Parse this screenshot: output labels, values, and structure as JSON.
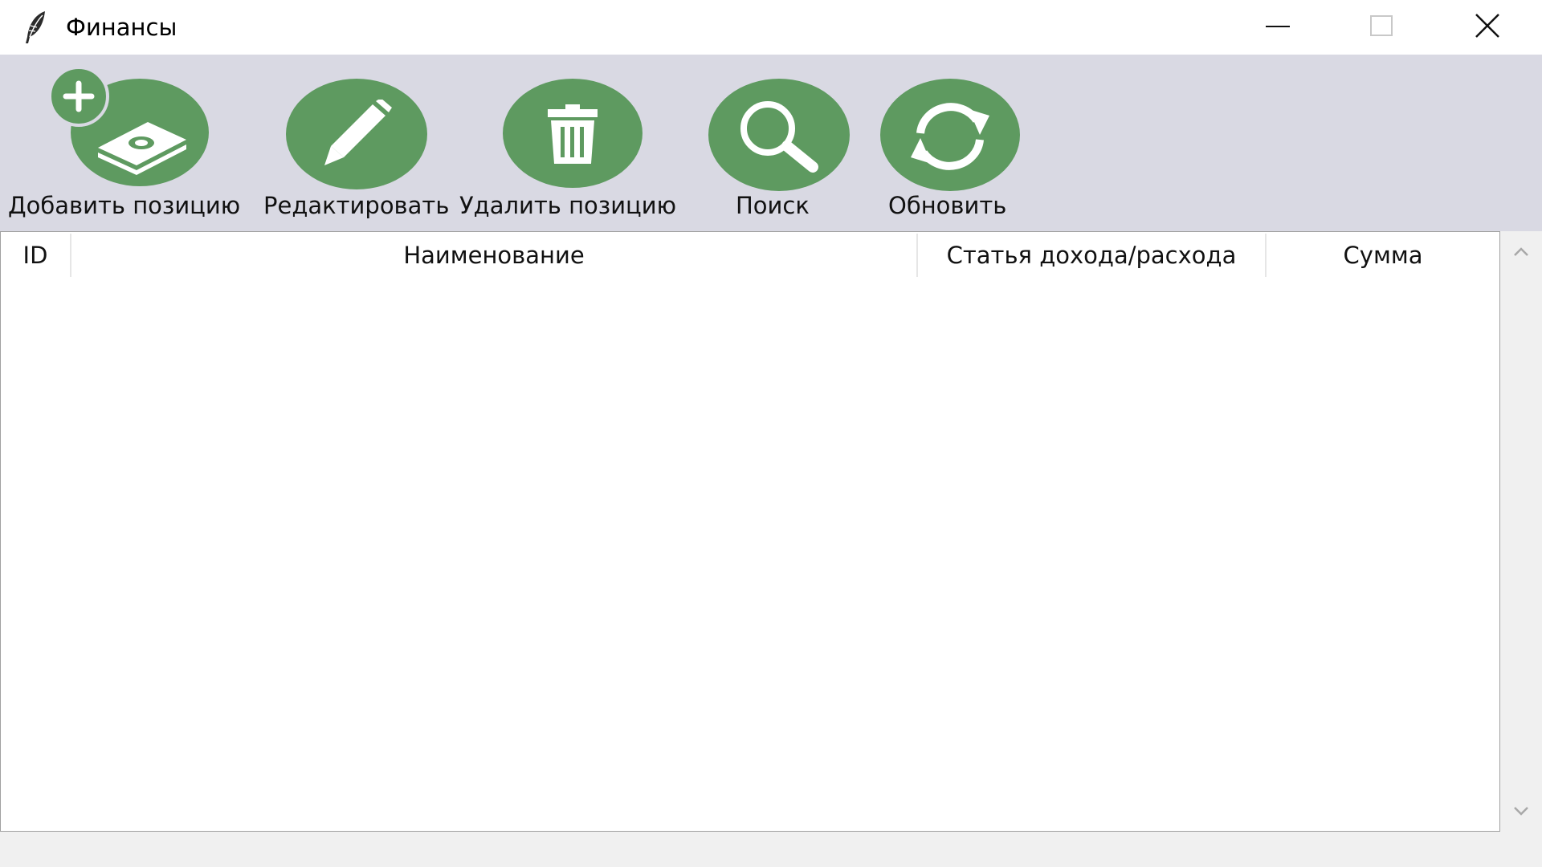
{
  "window": {
    "title": "Финансы",
    "app_icon": "feather-icon",
    "controls": {
      "minimize_icon": "minimize-icon",
      "maximize_icon": "maximize-icon",
      "close_icon": "close-icon"
    }
  },
  "toolbar": {
    "background": "#d9d9e3",
    "accent": "#5e9a60",
    "buttons": [
      {
        "label": "Добавить позицию",
        "icon": "add-money-icon"
      },
      {
        "label": "Редактировать",
        "icon": "pencil-icon"
      },
      {
        "label": "Удалить позицию",
        "icon": "trash-icon"
      },
      {
        "label": "Поиск",
        "icon": "search-icon"
      },
      {
        "label": "Обновить",
        "icon": "refresh-icon"
      }
    ]
  },
  "table": {
    "columns": [
      "ID",
      "Наименование",
      "Статья дохода/расхода",
      "Сумма"
    ],
    "rows": []
  },
  "scrollbar": {
    "up_icon": "chevron-up-icon",
    "down_icon": "chevron-down-icon"
  }
}
